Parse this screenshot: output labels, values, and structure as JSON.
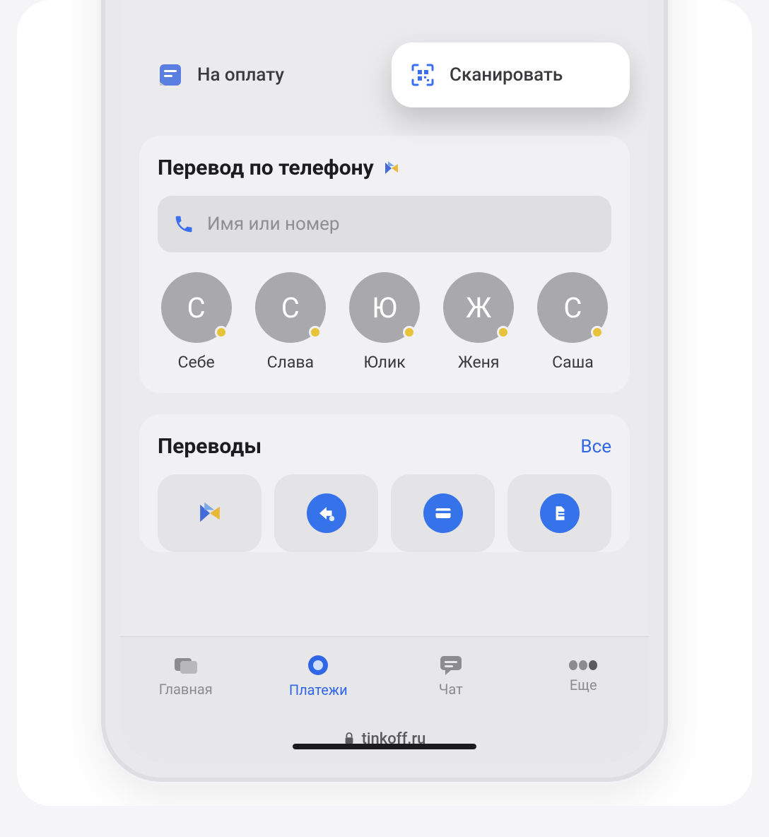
{
  "chips": {
    "pay": "На оплату",
    "scan": "Сканировать"
  },
  "phone_transfer": {
    "title": "Перевод по телефону",
    "placeholder": "Имя или номер",
    "contacts": [
      {
        "initial": "С",
        "name": "Себе"
      },
      {
        "initial": "С",
        "name": "Слава"
      },
      {
        "initial": "Ю",
        "name": "Юлик"
      },
      {
        "initial": "Ж",
        "name": "Женя"
      },
      {
        "initial": "С",
        "name": "Саша"
      }
    ]
  },
  "transfers": {
    "title": "Переводы",
    "all": "Все"
  },
  "tabs": {
    "home": "Главная",
    "payments": "Платежи",
    "chat": "Чат",
    "more": "Еще"
  },
  "browser": {
    "domain": "tinkoff.ru"
  }
}
